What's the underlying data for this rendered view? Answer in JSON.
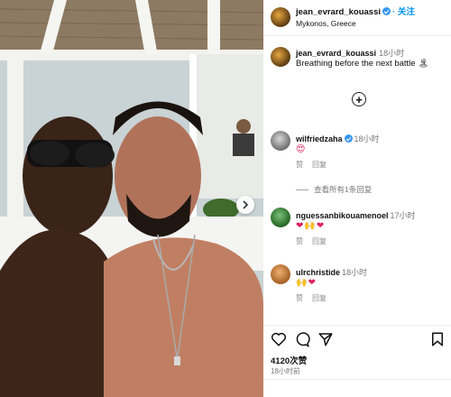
{
  "post": {
    "username": "jean_evrard_kouassi",
    "follow_label": "· 关注",
    "location": "Mykonos, Greece",
    "caption": {
      "username": "jean_evrard_kouassi",
      "time": "18小时",
      "text": "Breathing before the next battle 🏝"
    }
  },
  "comments": [
    {
      "username": "wilfriedzaha",
      "time": "18小时",
      "text": "😍",
      "like_label": "赞",
      "reply_label": "回复",
      "verified": true
    },
    {
      "username": "nguessanbikouamenoel",
      "time": "17小时",
      "text": "❤🙌❤",
      "like_label": "赞",
      "reply_label": "回复",
      "verified": false
    },
    {
      "username": "ulrchristide",
      "time": "18小时",
      "text": "🙌❤",
      "like_label": "赞",
      "reply_label": "回复",
      "verified": false
    }
  ],
  "view_all_replies": "查看所有1条回复",
  "likes": "4120次赞",
  "posted_time": "18小时前",
  "icons": [
    "heart-icon",
    "comment-icon",
    "share-icon",
    "bookmark-icon",
    "add-icon",
    "next-arrow-icon"
  ],
  "colors": {
    "accent": "#0095f6",
    "verified": "#3897f0"
  }
}
